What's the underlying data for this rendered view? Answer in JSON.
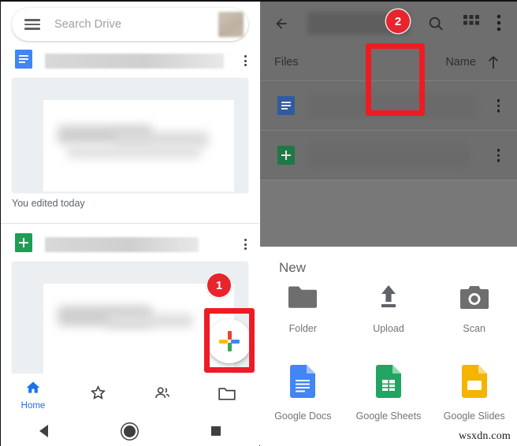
{
  "left": {
    "search": {
      "placeholder": "Search Drive",
      "menu_icon": "hamburger-icon",
      "avatar": "user-avatar"
    },
    "files": [
      {
        "type": "google-docs",
        "title_redacted": true,
        "edited_text": "You edited today"
      },
      {
        "type": "google-sheets",
        "title_redacted": true,
        "edited_text": ""
      }
    ],
    "fab": {
      "icon": "google-plus-icon",
      "label": ""
    },
    "bottom_nav": [
      {
        "id": "home",
        "label": "Home",
        "icon": "home-icon",
        "active": true
      },
      {
        "id": "starred",
        "label": "",
        "icon": "star-icon",
        "active": false
      },
      {
        "id": "shared",
        "label": "",
        "icon": "people-icon",
        "active": false
      },
      {
        "id": "files",
        "label": "",
        "icon": "folder-icon",
        "active": false
      }
    ],
    "system_nav": [
      {
        "id": "back",
        "icon": "back-triangle-icon"
      },
      {
        "id": "home",
        "icon": "home-circle-icon"
      },
      {
        "id": "recents",
        "icon": "recents-square-icon"
      }
    ]
  },
  "right": {
    "topbar": {
      "back_icon": "back-arrow-icon",
      "search_icon": "search-icon",
      "grid_icon": "grid-view-icon",
      "more_icon": "more-vertical-icon"
    },
    "list_header": {
      "left_label": "Files",
      "sort_label": "Name",
      "sort_direction_icon": "arrow-up-icon"
    },
    "rows": [
      {
        "type": "google-docs",
        "title_redacted": true
      },
      {
        "type": "google-sheets",
        "title_redacted": true
      }
    ],
    "sheet": {
      "title": "New",
      "row1": [
        {
          "id": "folder",
          "label": "Folder",
          "icon": "folder-icon"
        },
        {
          "id": "upload",
          "label": "Upload",
          "icon": "upload-icon"
        },
        {
          "id": "scan",
          "label": "Scan",
          "icon": "camera-icon"
        }
      ],
      "row2": [
        {
          "id": "google-docs",
          "label": "Google Docs",
          "icon": "google-docs-icon",
          "color": "#4285f4"
        },
        {
          "id": "google-sheets",
          "label": "Google Sheets",
          "icon": "google-sheets-icon",
          "color": "#22a463"
        },
        {
          "id": "google-slides",
          "label": "Google Slides",
          "icon": "google-slides-icon",
          "color": "#f4b400"
        }
      ]
    }
  },
  "annotations": {
    "step1": {
      "number": "1",
      "target": "new-fab-button"
    },
    "step2": {
      "number": "2",
      "target": "upload-tile"
    },
    "highlight_color": "#ed1c24"
  },
  "watermark": "wsxdn.com"
}
